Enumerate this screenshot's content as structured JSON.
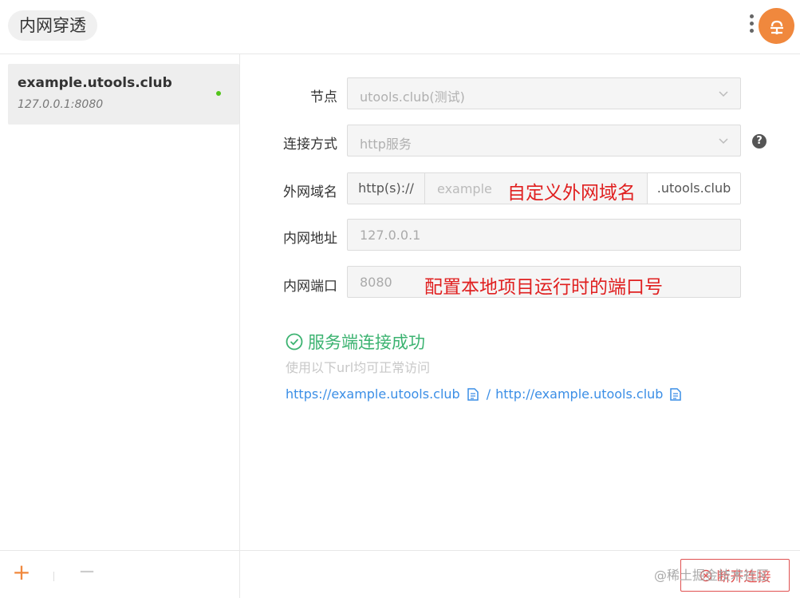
{
  "header": {
    "title": "内网穿透",
    "more_icon": "more-vertical-icon",
    "avatar_icon": "cloud-network-icon",
    "accent_color": "#f0883d"
  },
  "sidebar": {
    "items": [
      {
        "domain": "example.utools.club",
        "address": "127.0.0.1:8080",
        "status": "connected",
        "status_color": "#52c41a"
      }
    ],
    "add_label": "+",
    "remove_label": "−"
  },
  "form": {
    "node": {
      "label": "节点",
      "value": "utools.club(测试)"
    },
    "connection": {
      "label": "连接方式",
      "value": "http服务"
    },
    "domain": {
      "label": "外网域名",
      "prefix": "http(s)://",
      "placeholder": "example",
      "suffix": ".utools.club"
    },
    "local_address": {
      "label": "内网地址",
      "placeholder": "127.0.0.1"
    },
    "local_port": {
      "label": "内网端口",
      "placeholder": "8080"
    }
  },
  "annotations": {
    "domain_note": "自定义外网域名",
    "port_note": "配置本地项目运行时的端口号"
  },
  "status": {
    "message": "服务端连接成功",
    "hint": "使用以下url均可正常访问",
    "https_url": "https://example.utools.club",
    "http_url": "http://example.utools.club",
    "separator": "/",
    "success_color": "#3cb371"
  },
  "footer": {
    "disconnect_label": "断开连接",
    "watermark": "@稀土掘金技术社区"
  }
}
